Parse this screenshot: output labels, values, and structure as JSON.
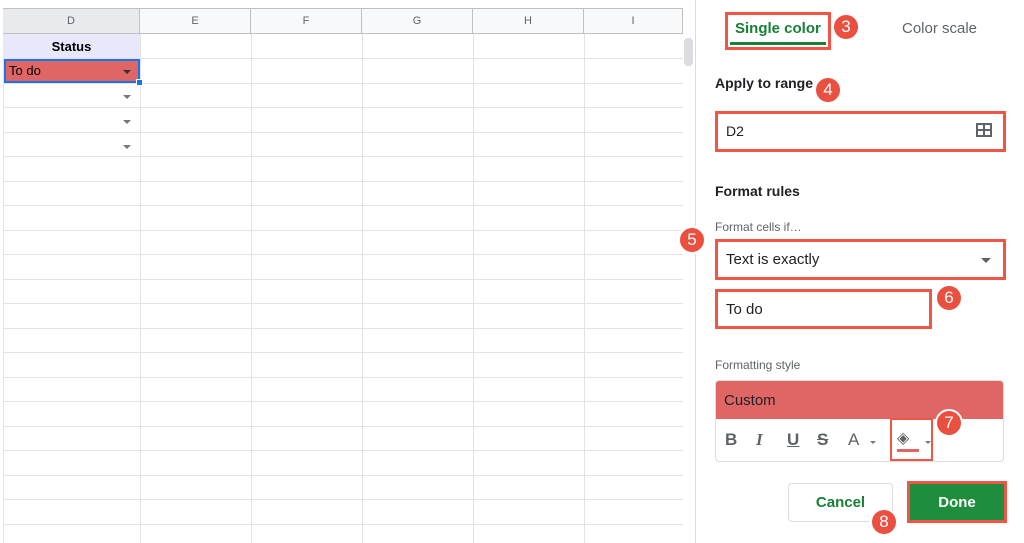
{
  "sheet": {
    "columns": [
      "D",
      "E",
      "F",
      "G",
      "H",
      "I"
    ],
    "header_cell": "Status",
    "selected_cell_value": "To do",
    "colors": {
      "header_fill": "#e8e8fb",
      "todo_fill": "#e06666",
      "selection": "#1a73e8"
    }
  },
  "panel": {
    "tabs": [
      {
        "label": "Single color",
        "active": true
      },
      {
        "label": "Color scale",
        "active": false
      }
    ],
    "apply_to_range_label": "Apply to range",
    "range_value": "D2",
    "format_rules_label": "Format rules",
    "format_cells_if_label": "Format cells if…",
    "condition_value": "Text is exactly",
    "condition_text_value": "To do",
    "formatting_style_label": "Formatting style",
    "style_preview_label": "Custom",
    "style_toolbar": {
      "bold": "B",
      "italic": "I",
      "underline": "U",
      "strikethrough": "S",
      "text_color": "A"
    },
    "cancel_label": "Cancel",
    "done_label": "Done",
    "colors": {
      "accent": "#188038",
      "done_bg": "#1e8e3e",
      "annotation": "#ea4f3f"
    }
  },
  "annotations": [
    "3",
    "4",
    "5",
    "6",
    "7",
    "8"
  ]
}
